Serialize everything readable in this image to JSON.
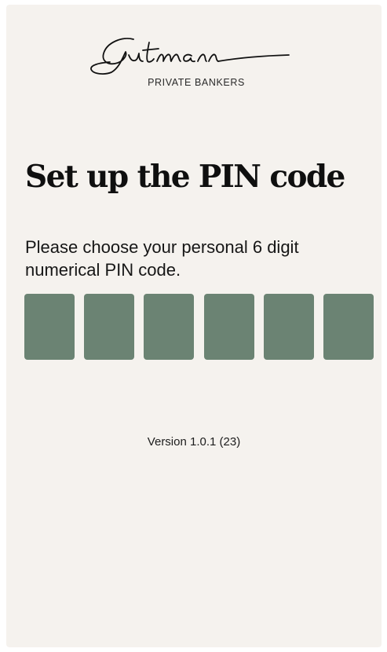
{
  "brand": {
    "name": "Gutmann",
    "subtitle": "PRIVATE BANKERS"
  },
  "setup": {
    "title": "Set up the PIN code",
    "description": "Please choose your personal 6 digit numerical PIN code.",
    "pin_length": 6
  },
  "footer": {
    "version": "Version 1.0.1 (23)"
  },
  "colors": {
    "background": "#f5f2ee",
    "pin_box": "#6b8373",
    "text": "#0f0f0f"
  }
}
